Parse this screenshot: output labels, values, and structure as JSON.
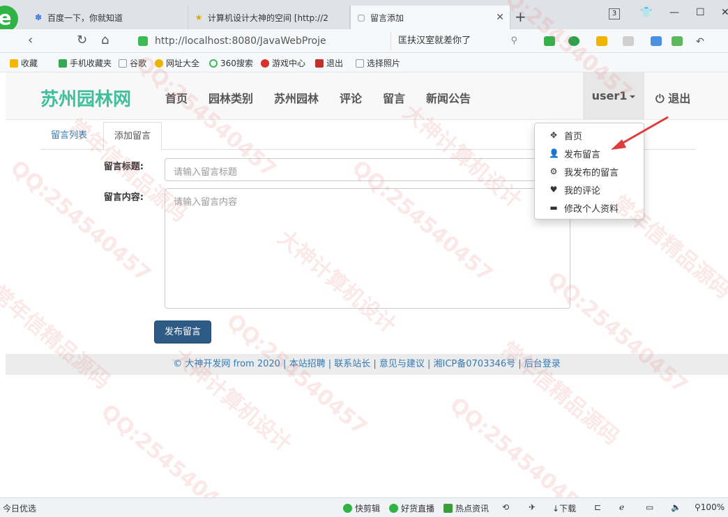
{
  "browser": {
    "tabs": [
      {
        "title": "百度一下，你就知道",
        "active": false
      },
      {
        "title": "计算机设计大神的空间 [http://2",
        "active": false
      },
      {
        "title": "留言添加",
        "active": true
      }
    ],
    "window_count": "3",
    "url": "http://localhost:8080/JavaWebProje",
    "search_text": "匡扶汉室就差你了",
    "bookmarks": [
      "收藏",
      "手机收藏夹",
      "谷歌",
      "网址大全",
      "360搜索",
      "游戏中心",
      "退出",
      "选择照片"
    ],
    "status_left": "今日优选",
    "status_items": [
      "快剪辑",
      "好货直播",
      "热点资讯",
      "下载"
    ],
    "zoom": "100%"
  },
  "site": {
    "brand": "苏州园林网",
    "nav": [
      "首页",
      "园林类别",
      "苏州园林",
      "评论",
      "留言",
      "新闻公告"
    ],
    "user": "user1",
    "logout": "退出"
  },
  "dropdown": {
    "items": [
      {
        "label": "首页",
        "icon": "move-icon"
      },
      {
        "label": "发布留言",
        "icon": "user-icon"
      },
      {
        "label": "我发布的留言",
        "icon": "gear-icon"
      },
      {
        "label": "我的评论",
        "icon": "heart-icon"
      },
      {
        "label": "修改个人资料",
        "icon": "card-icon"
      }
    ]
  },
  "content": {
    "tabs": [
      "留言列表",
      "添加留言"
    ],
    "title_label": "留言标题:",
    "title_placeholder": "请输入留言标题",
    "content_label": "留言内容:",
    "content_placeholder": "请输入留言内容",
    "submit": "发布留言"
  },
  "footer": "© 大神开发网 from 2020 | 本站招聘 | 联系站长 | 意见与建议 | 湘ICP备0703346号 | 后台登录",
  "watermarks": [
    "QQ:254540457",
    "大神计算机设计",
    "常年信精品源码"
  ],
  "colors": {
    "brand": "#3fbf9b",
    "link": "#337ab7",
    "primary_button": "#2e5b86",
    "annotation_arrow": "#e03c3c"
  }
}
